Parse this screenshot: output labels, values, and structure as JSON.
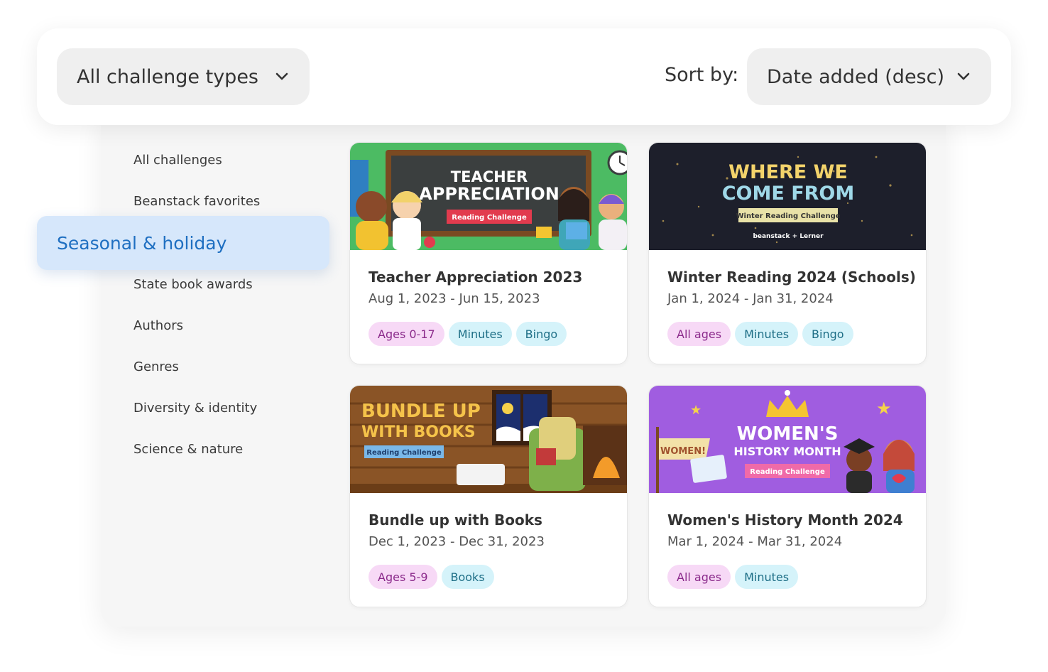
{
  "filters": {
    "type_value": "All challenge types",
    "sort_label": "Sort by:",
    "sort_value": "Date added (desc)"
  },
  "sidebar": {
    "items": [
      {
        "label": "All challenges"
      },
      {
        "label": "Beanstack favorites"
      },
      {
        "label": "Seasonal & holiday",
        "active": true
      },
      {
        "label": "State book awards"
      },
      {
        "label": "Authors"
      },
      {
        "label": "Genres"
      },
      {
        "label": "Diversity & identity"
      },
      {
        "label": "Science & nature"
      }
    ]
  },
  "cards": [
    {
      "title": "Teacher Appreciation 2023",
      "dates": "Aug 1, 2023 - Jun 15, 2023",
      "tags": [
        "Ages 0-17",
        "Minutes",
        "Bingo"
      ],
      "banner": {
        "line1": "TEACHER",
        "line2": "APPRECIATION",
        "ribbon": "Reading Challenge"
      }
    },
    {
      "title": "Winter Reading 2024 (Schools)",
      "dates": "Jan 1, 2024 - Jan 31, 2024",
      "tags": [
        "All ages",
        "Minutes",
        "Bingo"
      ],
      "banner": {
        "line1": "WHERE WE",
        "line2": "COME FROM",
        "ribbon": "Winter Reading Challenge",
        "footer": "beanstack + Lerner"
      }
    },
    {
      "title": "Bundle up with Books",
      "dates": "Dec 1, 2023 - Dec 31, 2023",
      "tags": [
        "Ages 5-9",
        "Books"
      ],
      "banner": {
        "line1": "BUNDLE UP",
        "line2": "WITH BOOKS",
        "ribbon": "Reading Challenge"
      }
    },
    {
      "title": "Women's History Month 2024",
      "dates": "Mar 1, 2024 - Mar 31, 2024",
      "tags": [
        "All ages",
        "Minutes"
      ],
      "banner": {
        "line1": "WOMEN'S",
        "line2": "HISTORY MONTH",
        "ribbon": "Reading Challenge",
        "sign": "WOMEN!"
      }
    }
  ],
  "colors": {
    "active_bg": "#d6e7fb",
    "active_text": "#1f6fc1",
    "age_tag_bg": "#f7d9f6",
    "meta_tag_bg": "#d5f3fa"
  }
}
